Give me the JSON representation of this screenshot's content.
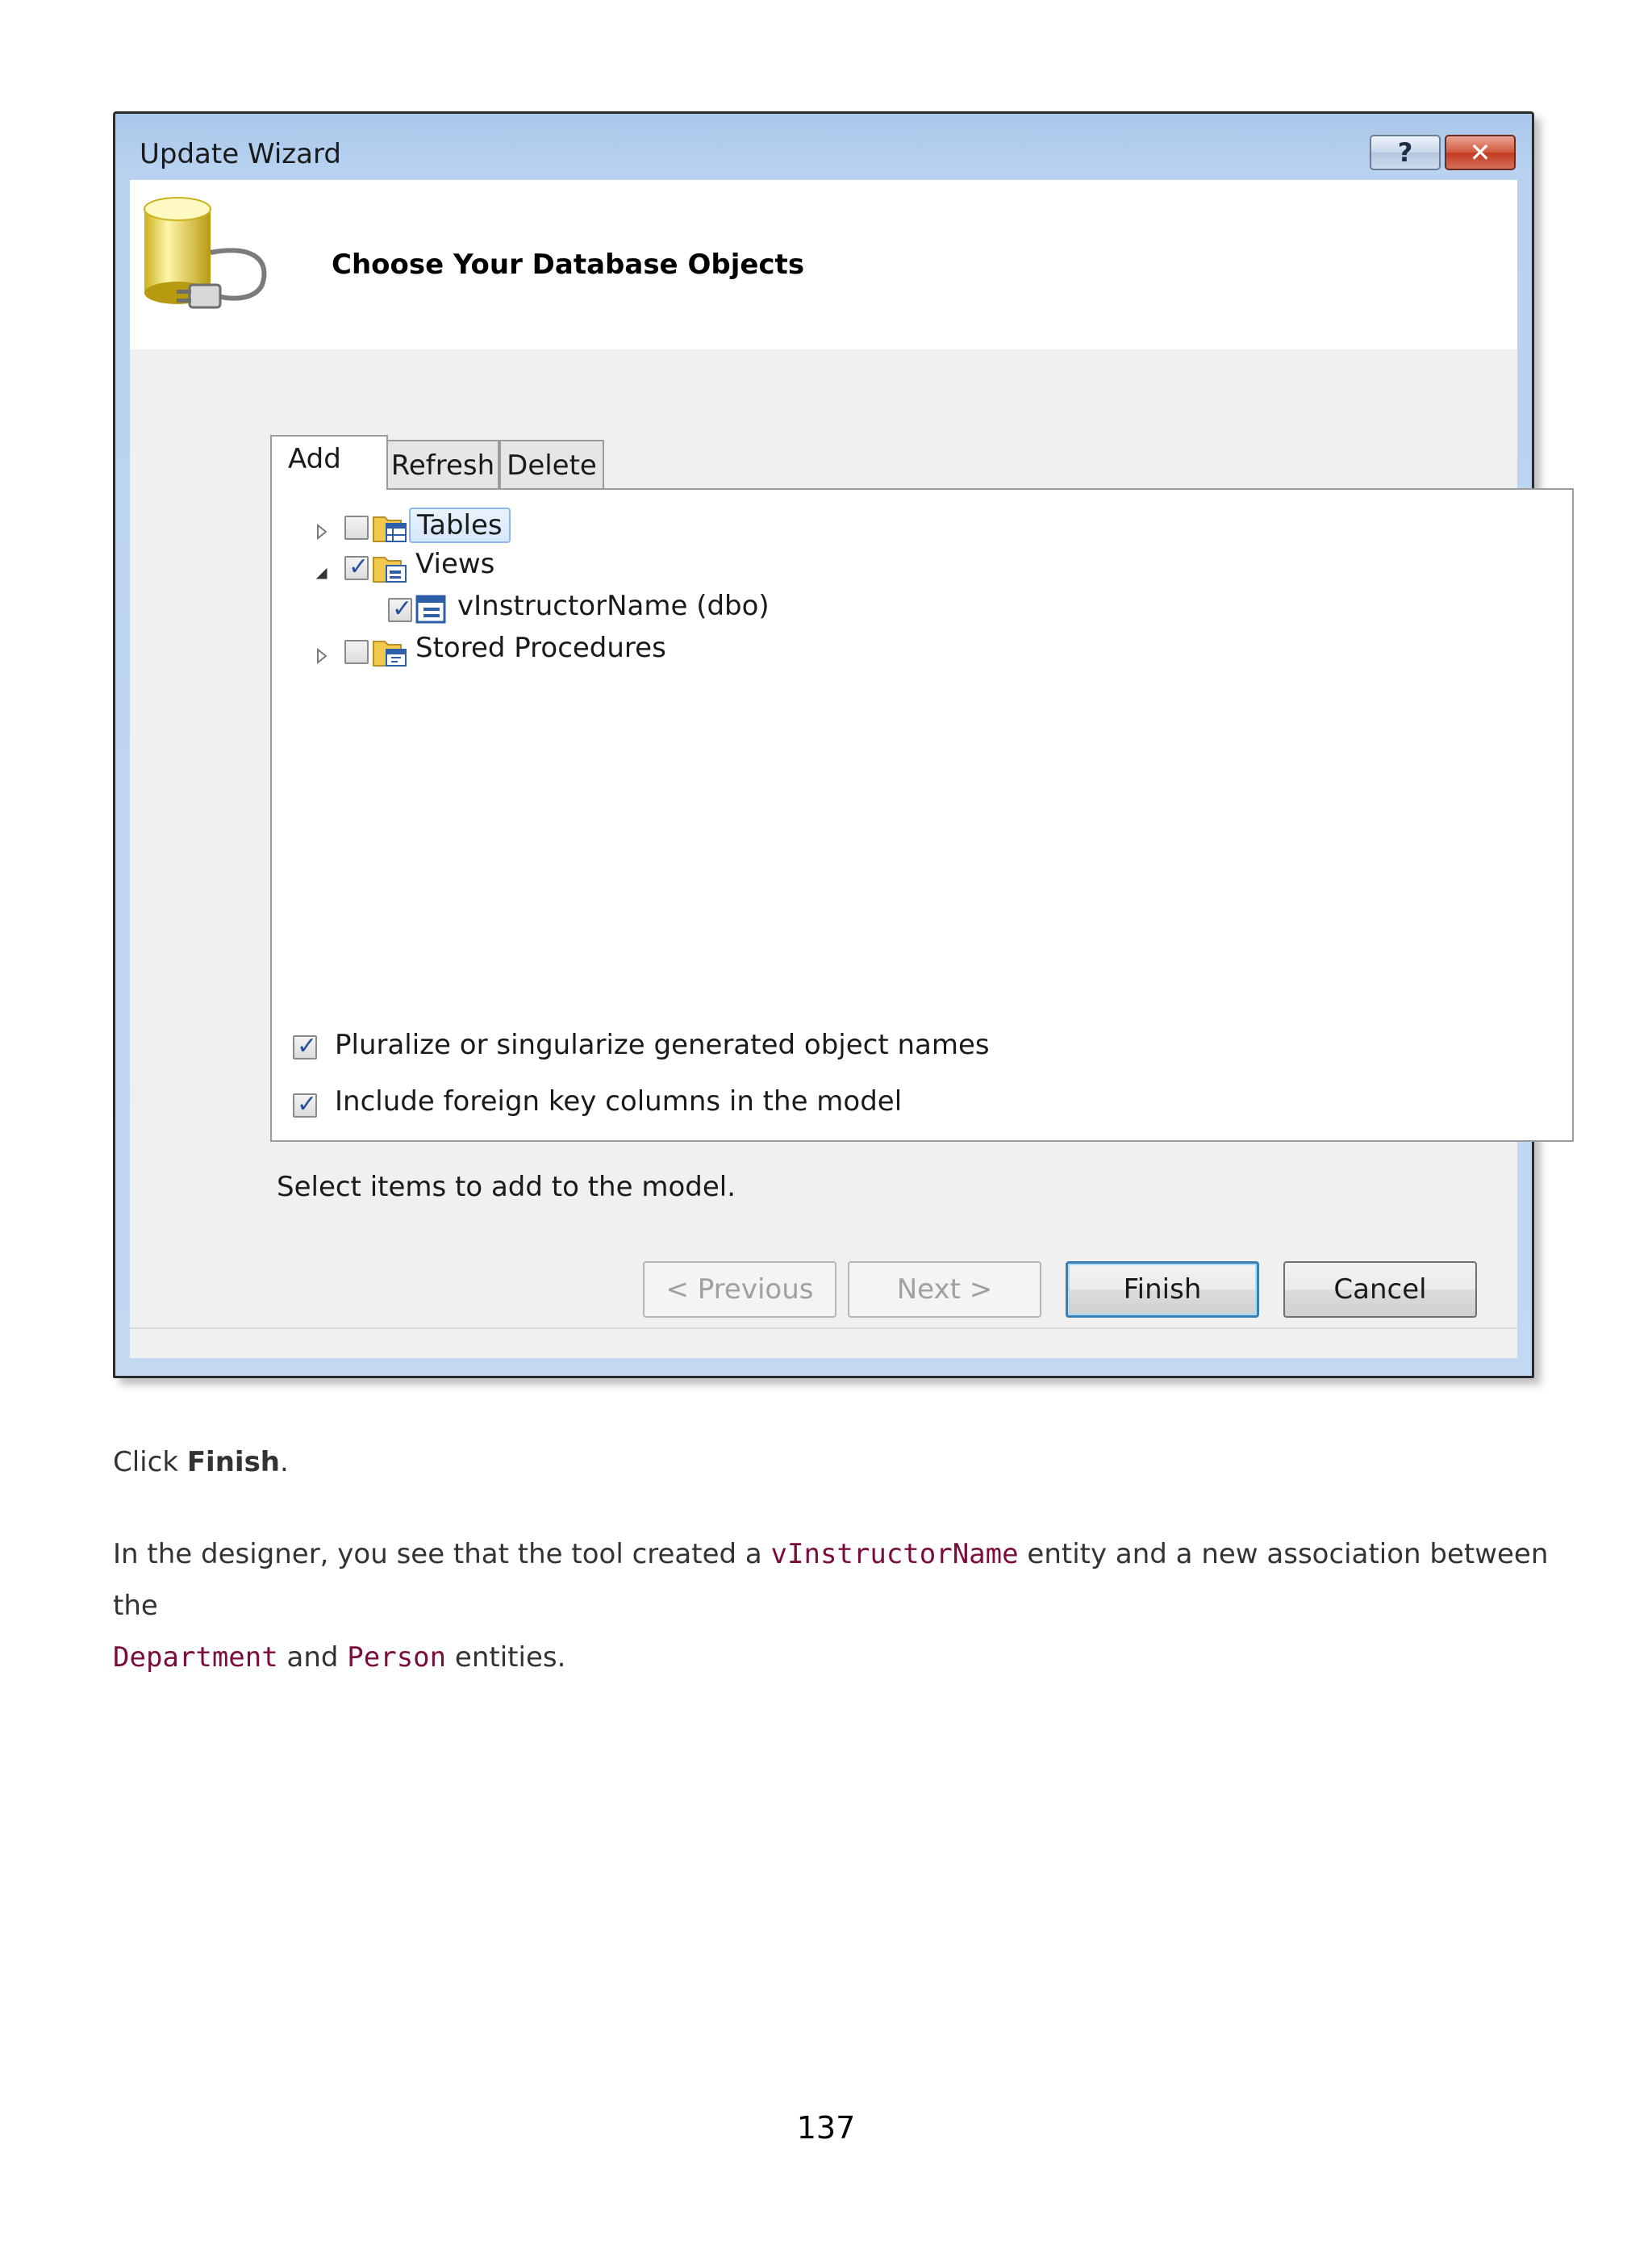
{
  "dialog": {
    "title": "Update Wizard",
    "help_glyph": "?",
    "close_glyph": "✕",
    "header_title": "Choose Your Database Objects",
    "tabs": [
      {
        "label": "Add"
      },
      {
        "label": "Refresh"
      },
      {
        "label": "Delete"
      }
    ],
    "tree": {
      "tables": {
        "label": "Tables",
        "checked": false,
        "expanded": false
      },
      "views": {
        "label": "Views",
        "checked": true,
        "expanded": true,
        "children": [
          {
            "label": "vInstructorName (dbo)",
            "checked": true
          }
        ]
      },
      "stored_procedures": {
        "label": "Stored Procedures",
        "checked": false,
        "expanded": false
      }
    },
    "options": {
      "pluralize": {
        "label": "Pluralize or singularize generated object names",
        "checked": true
      },
      "foreign_keys": {
        "label": "Include foreign key columns in the model",
        "checked": true
      }
    },
    "status": "Select items to add to the model.",
    "buttons": {
      "previous": "< Previous",
      "next": "Next >",
      "finish": "Finish",
      "cancel": "Cancel"
    }
  },
  "document": {
    "para1": {
      "prefix": "Click ",
      "bold": "Finish",
      "suffix": "."
    },
    "para2": {
      "t1": "In the designer, you see that the tool created a ",
      "code1": "vInstructorName",
      "t2": " entity and a new association between the",
      "code2": "Department",
      "t3": " and ",
      "code3": "Person",
      "t4": " entities."
    },
    "page_number": "137"
  },
  "colors": {
    "code_text": "#7a0d3a",
    "window_frame": "#b8d2f0",
    "checkmark": "#2a4fa0"
  }
}
